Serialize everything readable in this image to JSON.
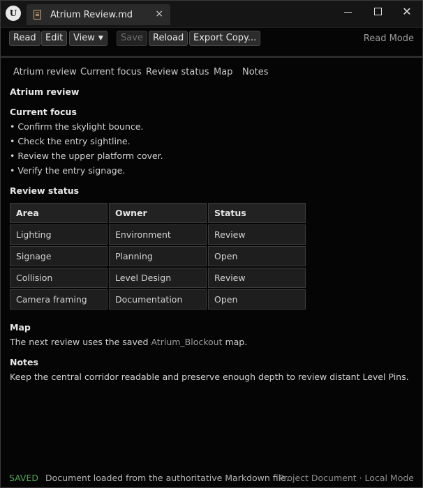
{
  "app": {
    "logo_letter": "U"
  },
  "tab": {
    "title": "Atrium Review.md",
    "close": "×"
  },
  "window_controls": {
    "close": "✕"
  },
  "toolbar": {
    "read": "Read",
    "edit": "Edit",
    "view": "View",
    "save": "Save",
    "reload": "Reload",
    "export": "Export Copy...",
    "mode": "Read Mode"
  },
  "nav": [
    "Atrium review",
    "Current focus",
    "Review status",
    "Map",
    "Notes"
  ],
  "doc": {
    "title": "Atrium review",
    "focus_heading": "Current focus",
    "focus_items": [
      "• Confirm the skylight bounce.",
      "• Check the entry sightline.",
      "• Review the upper platform cover.",
      "• Verify the entry signage."
    ],
    "status_heading": "Review status",
    "table": {
      "headers": [
        "Area",
        "Owner",
        "Status"
      ],
      "rows": [
        [
          "Lighting",
          "Environment",
          "Review"
        ],
        [
          "Signage",
          "Planning",
          "Open"
        ],
        [
          "Collision",
          "Level Design",
          "Review"
        ],
        [
          "Camera framing",
          "Documentation",
          "Open"
        ]
      ]
    },
    "map_heading": "Map",
    "map_text_before": "The next review uses the saved ",
    "map_link": "Atrium_Blockout",
    "map_text_after": " map.",
    "notes_heading": "Notes",
    "notes_text": "Keep the central corridor readable and preserve enough depth to review distant Level Pins."
  },
  "status": {
    "saved": "SAVED",
    "message": "Document loaded from the authoritative Markdown file.",
    "right": "Project Document · Local Mode"
  },
  "colors": {
    "saved": "#59a35a",
    "link": "#9d9d9d",
    "background": "#050505"
  }
}
